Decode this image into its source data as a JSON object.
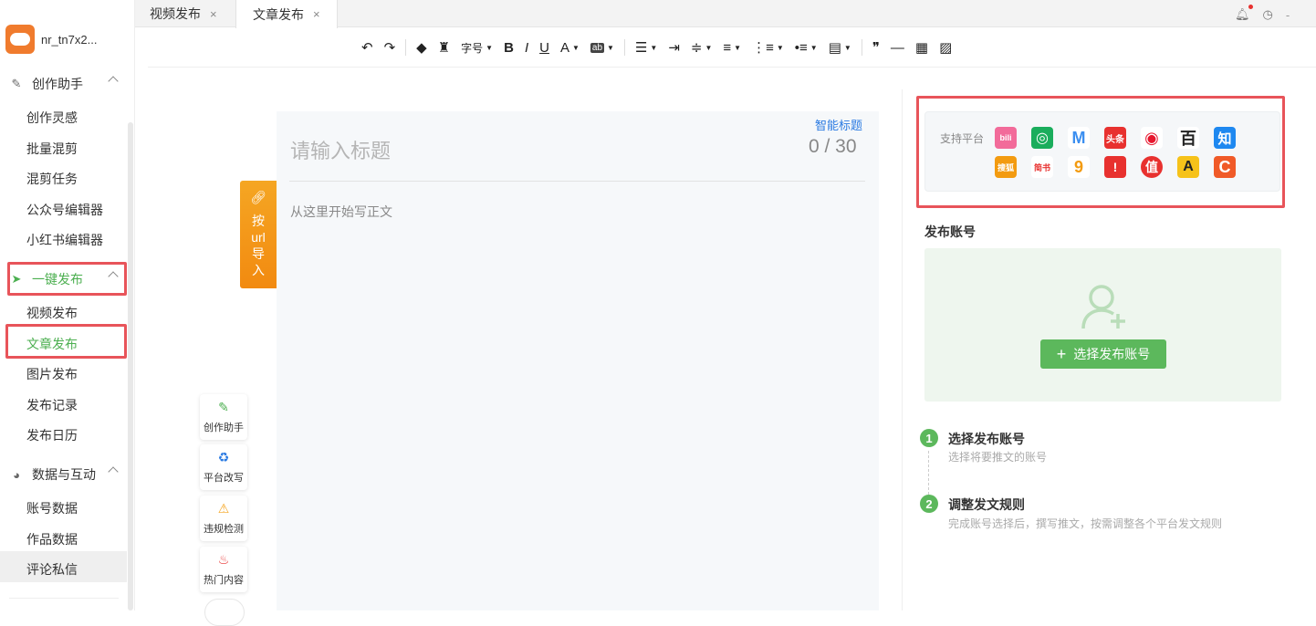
{
  "user": {
    "name": "nr_tn7x2..."
  },
  "sidebar": {
    "sections": [
      {
        "label": "创作助手",
        "icon": "pen-icon",
        "items": [
          "创作灵感",
          "批量混剪",
          "混剪任务",
          "公众号编辑器",
          "小红书编辑器"
        ]
      },
      {
        "label": "一键发布",
        "icon": "send-icon",
        "items": [
          "视频发布",
          "文章发布",
          "图片发布",
          "发布记录",
          "发布日历"
        ]
      },
      {
        "label": "数据与互动",
        "icon": "pie-chart-icon",
        "items": [
          "账号数据",
          "作品数据",
          "评论私信"
        ]
      }
    ],
    "active_section": "一键发布",
    "active_item": "文章发布"
  },
  "tabs": [
    {
      "label": "视频发布",
      "close": "×"
    },
    {
      "label": "文章发布",
      "close": "×"
    }
  ],
  "toolbar": {
    "font_size_label": "字号",
    "bold": "B",
    "italic": "I",
    "underline": "U",
    "font_color": "A",
    "highlight": "ab",
    "quote": "❞",
    "hr": "—"
  },
  "editor": {
    "smart_title": "智能标题",
    "title_placeholder": "请输入标题",
    "counter": "0 / 30",
    "body_placeholder": "从这里开始写正文",
    "url_import": "按url导入"
  },
  "tools": [
    {
      "label": "创作助手",
      "icon": "pen-icon"
    },
    {
      "label": "平台改写",
      "icon": "recycle-icon"
    },
    {
      "label": "违规检测",
      "icon": "warning-search-icon"
    },
    {
      "label": "热门内容",
      "icon": "fire-icon"
    }
  ],
  "platforms": {
    "label": "支持平台",
    "row1": [
      {
        "name": "bilibili",
        "text": "bili",
        "color": "#f26b9a"
      },
      {
        "name": "wechat-channels",
        "text": "◎",
        "color": "#1aad5c"
      },
      {
        "name": "maimai",
        "text": "M",
        "color": "#3a8ef0"
      },
      {
        "name": "toutiao",
        "text": "头条",
        "color": "#e8312f"
      },
      {
        "name": "weibo",
        "text": "◉",
        "color": "#e6162d"
      },
      {
        "name": "baijiahao",
        "text": "百",
        "color": "#222222"
      },
      {
        "name": "zhihu",
        "text": "知",
        "color": "#1e88f0"
      }
    ],
    "row2": [
      {
        "name": "sohu",
        "text": "搜狐",
        "color": "#f39b10"
      },
      {
        "name": "jianshu",
        "text": "简书",
        "color": "#ffffff"
      },
      {
        "name": "yidian",
        "text": "9",
        "color": "#ffffff"
      },
      {
        "name": "yidianzixun",
        "text": "!",
        "color": "#e8312f"
      },
      {
        "name": "smzdm",
        "text": "值",
        "color": "#e8312f"
      },
      {
        "name": "acfun",
        "text": "A",
        "color": "#f6c21a"
      },
      {
        "name": "csdn",
        "text": "C",
        "color": "#f05a28"
      }
    ]
  },
  "account": {
    "title": "发布账号",
    "button": "选择发布账号",
    "button_plus": "+"
  },
  "steps": [
    {
      "num": "1",
      "title": "选择发布账号",
      "desc": "选择将要推文的账号"
    },
    {
      "num": "2",
      "title": "调整发文规则",
      "desc": "完成账号选择后，撰写推文，按需调整各个平台发文规则"
    }
  ],
  "colors": {
    "accent_green": "#5cb85c",
    "highlight_red": "#e8545a",
    "orange": "#f5a623",
    "link_blue": "#2a7ae2"
  }
}
